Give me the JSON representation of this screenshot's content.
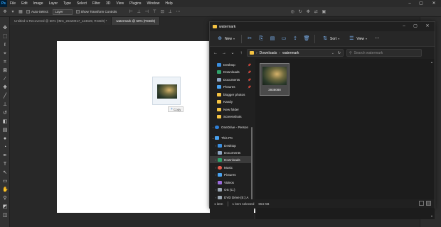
{
  "photoshop": {
    "logo": "Ps",
    "menu": [
      "File",
      "Edit",
      "Image",
      "Layer",
      "Type",
      "Select",
      "Filter",
      "3D",
      "View",
      "Plugins",
      "Window",
      "Help"
    ],
    "options": {
      "auto_select_label": "Auto-Select:",
      "auto_select_value": "Layer",
      "transform_label": "Show Transform Controls"
    },
    "tabs": [
      {
        "label": "Untitled-1-Recovered @ 50% (IMG_20220917_124639, RGB/8) *",
        "active": false
      },
      {
        "label": "watermark @ 50% (RGB/8)",
        "active": true
      }
    ],
    "drag": {
      "copy_label": "Copy"
    }
  },
  "explorer": {
    "title": "watermark",
    "toolbar": {
      "new_label": "New",
      "sort_label": "Sort",
      "view_label": "View"
    },
    "address": {
      "path": [
        "Downloads",
        "watermark"
      ]
    },
    "search": {
      "placeholder": "Search watermark"
    },
    "nav": [
      {
        "label": "Desktop",
        "color": "#3b8fe0",
        "pinned": true
      },
      {
        "label": "Downloads",
        "color": "#2fa36b",
        "pinned": true
      },
      {
        "label": "Documents",
        "color": "#8fa6c4",
        "pinned": true
      },
      {
        "label": "Pictures",
        "color": "#4aa3f0",
        "pinned": true
      },
      {
        "label": "blogger photos",
        "color": "#f5c342"
      },
      {
        "label": "Kandy",
        "color": "#f5c342"
      },
      {
        "label": "New folder",
        "color": "#f5c342"
      },
      {
        "label": "Screenshots",
        "color": "#f5c342"
      },
      {
        "label": "OneDrive - Person",
        "color": "#2f7fd6"
      },
      {
        "label": "This PC",
        "color": "#4aa3f0"
      },
      {
        "label": "Desktop",
        "color": "#3b8fe0"
      },
      {
        "label": "Documents",
        "color": "#8fa6c4"
      },
      {
        "label": "Downloads",
        "color": "#2fa36b",
        "selected": true
      },
      {
        "label": "Music",
        "color": "#e85b4c"
      },
      {
        "label": "Pictures",
        "color": "#4aa3f0"
      },
      {
        "label": "Videos",
        "color": "#9b6bdc"
      },
      {
        "label": "OS (C:)",
        "color": "#9aa6b2"
      },
      {
        "label": "DVD Drive (E:) A",
        "color": "#9aa6b2"
      }
    ],
    "file": {
      "name": "3938088"
    },
    "status": {
      "count": "1 item",
      "selected": "1 item selected",
      "size": "654 KB"
    }
  }
}
